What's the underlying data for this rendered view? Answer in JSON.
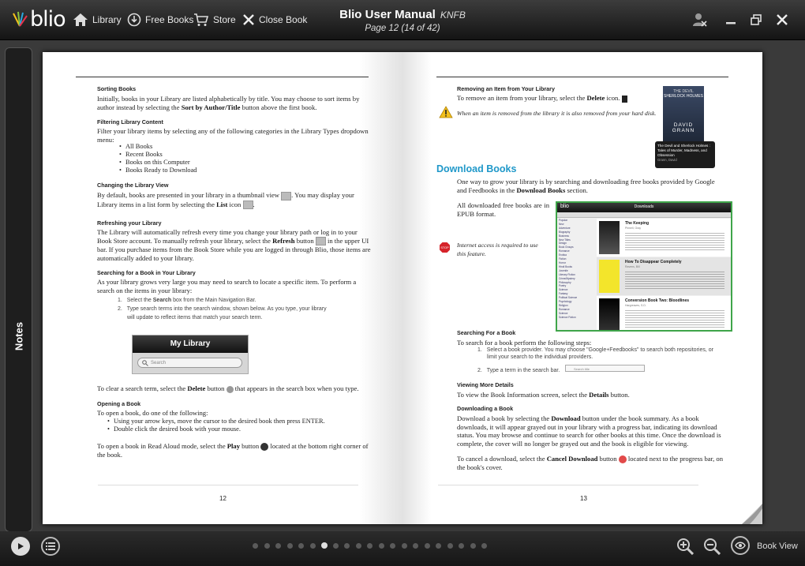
{
  "app": {
    "logo_text": "blio"
  },
  "toolbar": {
    "library_label": "Library",
    "free_books_label": "Free Books",
    "store_label": "Store",
    "close_book_label": "Close Book"
  },
  "header": {
    "title": "Blio User Manual",
    "author": "KNFB",
    "page_info": "Page 12 (14 of 42)"
  },
  "notes_tab": {
    "label": "Notes"
  },
  "left_page": {
    "number": "12",
    "sorting_heading": "Sorting Books",
    "sorting_text_1": "Initially, books in your Library are listed alphabetically by title. You may choose to sort items by author instead by selecting the ",
    "sorting_bold": "Sort by Author/Title",
    "sorting_text_2": " button above the first book.",
    "filter_heading": "Filtering Library Content",
    "filter_text": "Filter your library items by selecting any of the following categories in the Library Types dropdown menu:",
    "filter_items": [
      "All Books",
      "Recent Books",
      "Books on this Computer",
      "Books Ready to Download"
    ],
    "view_heading": "Changing the Library View",
    "view_text_1": "By default, books are presented in your library in a thumbnail view ",
    "view_text_2": ". You may display your Library items in a list form by selecting the ",
    "view_bold": "List",
    "view_text_3": " icon ",
    "refresh_heading": "Refreshing your Library",
    "refresh_text_1": "The Library will automatically refresh every time you change your library path or log in to your Book Store account. To manually refresh your library, select the ",
    "refresh_bold": "Refresh",
    "refresh_text_2": " button ",
    "refresh_text_3": " in the upper UI bar. If you purchase items from the Book Store while you are logged in through Blio, those items are automatically added to your library.",
    "search_heading": "Searching for a Book in Your Library",
    "search_text": "As your library grows very large you may need to search to locate a specific item. To perform a search on the items in your library:",
    "search_step1_a": "Select the ",
    "search_step1_bold": "Search",
    "search_step1_b": " box from the Main Navigation Bar.",
    "search_step2": "Type search terms into the search window, shown below. As you type, your library will update to reflect items that match your search term.",
    "mylibrary_title": "My Library",
    "search_placeholder": "Search",
    "clear_text_1": "To clear a search term, select the ",
    "clear_bold": "Delete",
    "clear_text_2": " button ",
    "clear_text_3": " that appears in the search box when you type.",
    "open_heading": "Opening a Book",
    "open_text": "To open a book, do one of the following:",
    "open_items": [
      "Using your arrow keys, move the cursor to the desired book then press ENTER.",
      "Double click the desired book with your mouse."
    ],
    "read_text_1": "To open a book in Read Aloud mode, select the ",
    "read_bold": "Play",
    "read_text_2": " button ",
    "read_text_3": " located at the bottom right corner of the book."
  },
  "right_page": {
    "number": "13",
    "remove_heading": "Removing an Item from Your Library",
    "remove_text_1": "To remove an item from your library, select the ",
    "remove_bold": "Delete",
    "remove_text_2": " icon.",
    "remove_warning": "When an item is removed from the library it is also removed from your hard disk.",
    "book_cover_title_1": "THE DEVIL",
    "book_cover_title_2": "SHERLOCK HOLMES",
    "book_cover_author": "DAVID GRANN",
    "book_caption": "The Devil and Sherlock Holmes : Tales of Murder, Madness, and Obsession",
    "book_caption_author": "Grann, David",
    "download_heading": "Download Books",
    "download_text_1": "One way to grow your library is by searching and downloading free books provided by Google and Feedbooks in the ",
    "download_bold": "Download Books",
    "download_text_2": " section.",
    "epub_text": "All downloaded free books are in EPUB format.",
    "internet_note": "Internet access is required to use this feature.",
    "shot_logo": "blio",
    "shot_title": "Downloads",
    "shot_categories": [
      "Popular",
      "New",
      "Adventure",
      "Biography",
      "Business",
      "New Titles",
      "Design",
      "Book Groups",
      "Romance",
      "Erotica",
      "Fiction",
      "Horror",
      "Hindi Books",
      "Juvenile",
      "Literary Fiction",
      "Crime/Mystery",
      "Philosophy",
      "Poetry",
      "Science",
      "Fantasy",
      "Political Science",
      "Psychology",
      "Religion",
      "Romance",
      "Science",
      "Science Fiction"
    ],
    "shot_books": [
      {
        "title": "The Keeping",
        "author": "Pinnell, Gray"
      },
      {
        "title": "How To Disappear Completely",
        "author": "Ravens, Bill"
      },
      {
        "title": "Conversion Book Two: Bloodlines",
        "author": "Hargreaves, S.D."
      }
    ],
    "searching_heading": "Searching For a Book",
    "searching_text": "To search for a book perform the following steps:",
    "searching_step1": "Select a book provider. You may choose \"Google+Feedbooks\" to search both repositories, or limit your search to the individual providers.",
    "searching_step2": "Type a term in the search bar.",
    "small_search_placeholder": "Search title",
    "details_heading": "Viewing More Details",
    "details_text_1": "To view the Book Information screen, select the ",
    "details_bold": "Details",
    "details_text_2": " button.",
    "dl_heading": "Downloading a Book",
    "dl_text_1": "Download a book by selecting the ",
    "dl_bold": "Download",
    "dl_text_2": " button under the book summary. As a book downloads, it will appear grayed out in your library with a progress bar, indicating its download status. You may browse and continue to search for other books at this time. Once the download is complete, the cover will no longer be grayed out and the book is eligible for viewing.",
    "cancel_text_1": "To cancel a download, select the ",
    "cancel_bold": "Cancel Download",
    "cancel_text_2": " button ",
    "cancel_text_3": " located next to the progress bar, on the book's cover."
  },
  "footer": {
    "view_mode_label": "Book View",
    "page_dots": 21,
    "active_dot": 6
  },
  "colors": {
    "accent": "#1f98c9",
    "toolbar": "#1a1a1a",
    "page": "#ffffff"
  }
}
